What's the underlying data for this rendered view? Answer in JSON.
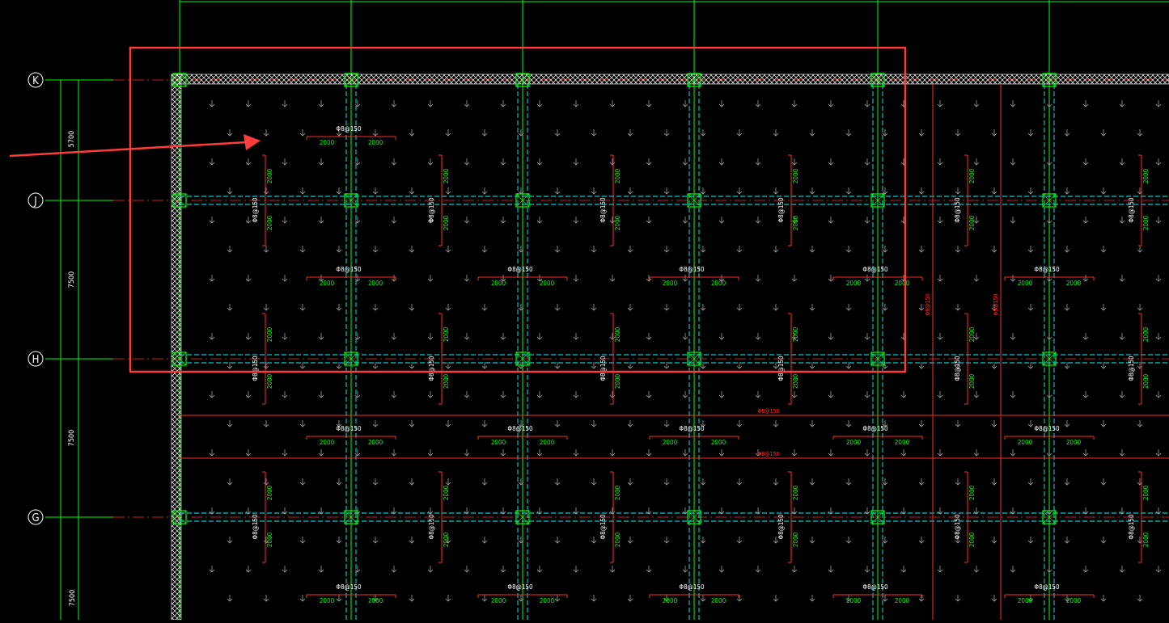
{
  "drawing": {
    "grid_axes": [
      "K",
      "J",
      "H",
      "G"
    ],
    "axis_dimensions": [
      "5700",
      "7500",
      "7500",
      "7500"
    ],
    "horizontal_rebar_label": "Φ8@150",
    "vertical_rebar_label": "Φ8@150",
    "span_lengths": [
      "2000",
      "2000"
    ],
    "strip_rebar_labels": [
      "Φ8@150",
      "Φ8@150"
    ],
    "vertical_red_labels": [
      "Φ8@150",
      "Φ8@150"
    ]
  },
  "colors": {
    "background": "#000000",
    "grid_line": "#00ff00",
    "dashed_beam": "#00ffff",
    "rebar": "#ff2a2a",
    "text_white": "#ffffff",
    "text_green": "#00ff00",
    "highlight_box": "#ff3b3b",
    "arrow": "#ff3b3b",
    "arrow_glyph": "#a0a0a0"
  },
  "icons": {
    "annotation_arrow": "red-arrow-icon",
    "slab_arrow": "down-arrow-icon",
    "column": "column-icon",
    "axis_bubble": "axis-bubble-icon"
  }
}
